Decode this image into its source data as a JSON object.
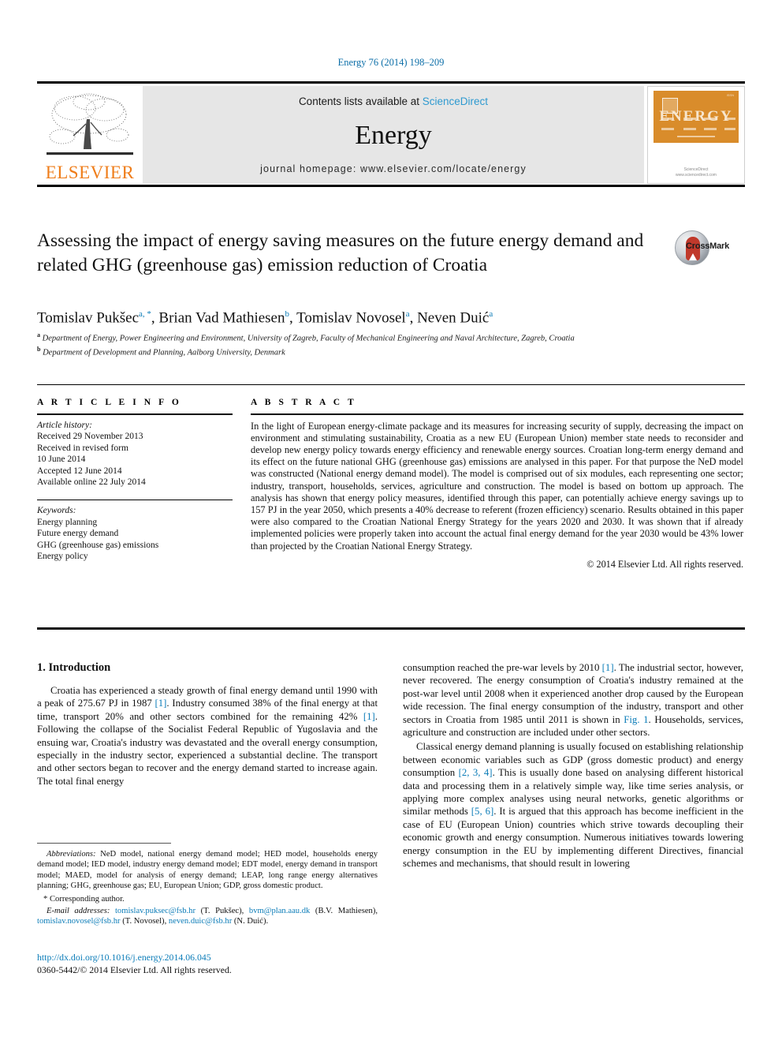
{
  "journal_ref": "Energy 76 (2014) 198–209",
  "masthead": {
    "contents_prefix": "Contents lists available at ",
    "sciencedirect": "ScienceDirect",
    "journal_name": "Energy",
    "homepage": "journal homepage: www.elsevier.com/locate/energy",
    "publisher_wordmark": "ELSEVIER",
    "cover_title": "ENERGY",
    "cover_footer": "ScienceDirect\nwww.sciencedirect.com",
    "accent_link_color": "#2e9ad0",
    "elsevier_orange": "#ef7d1a",
    "cover_orange": "#d98c2b"
  },
  "article": {
    "title": "Assessing the impact of energy saving measures on the future energy demand and related GHG (greenhouse gas) emission reduction of Croatia",
    "crossmark_label": "CrossMark",
    "authors": [
      {
        "name": "Tomislav Pukšec",
        "marks": "a, *"
      },
      {
        "name": "Brian Vad Mathiesen",
        "marks": "b"
      },
      {
        "name": "Tomislav Novosel",
        "marks": "a"
      },
      {
        "name": "Neven Duić",
        "marks": "a"
      }
    ],
    "affiliations": [
      {
        "mark": "a",
        "text": "Department of Energy, Power Engineering and Environment, University of Zagreb, Faculty of Mechanical Engineering and Naval Architecture, Zagreb, Croatia"
      },
      {
        "mark": "b",
        "text": "Department of Development and Planning, Aalborg University, Denmark"
      }
    ]
  },
  "article_info": {
    "heading": "A R T I C L E    I N F O",
    "history_label": "Article history:",
    "history": [
      "Received 29 November 2013",
      "Received in revised form",
      "10 June 2014",
      "Accepted 12 June 2014",
      "Available online 22 July 2014"
    ],
    "keywords_label": "Keywords:",
    "keywords": [
      "Energy planning",
      "Future energy demand",
      "GHG (greenhouse gas) emissions",
      "Energy policy"
    ]
  },
  "abstract": {
    "heading": "A B S T R A C T",
    "text": "In the light of European energy-climate package and its measures for increasing security of supply, decreasing the impact on environment and stimulating sustainability, Croatia as a new EU (European Union) member state needs to reconsider and develop new energy policy towards energy efficiency and renewable energy sources. Croatian long-term energy demand and its effect on the future national GHG (greenhouse gas) emissions are analysed in this paper. For that purpose the NeD model was constructed (National energy demand model). The model is comprised out of six modules, each representing one sector; industry, transport, households, services, agriculture and construction. The model is based on bottom up approach. The analysis has shown that energy policy measures, identified through this paper, can potentially achieve energy savings up to 157 PJ in the year 2050, which presents a 40% decrease to referent (frozen efficiency) scenario. Results obtained in this paper were also compared to the Croatian National Energy Strategy for the years 2020 and 2030. It was shown that if already implemented policies were properly taken into account the actual final energy demand for the year 2030 would be 43% lower than projected by the Croatian National Energy Strategy.",
    "copyright": "© 2014 Elsevier Ltd. All rights reserved."
  },
  "body": {
    "section_heading": "1. Introduction",
    "left_paragraph_1_a": "Croatia has experienced a steady growth of final energy demand until 1990 with a peak of 275.67 PJ in 1987 ",
    "left_ref_1": "[1]",
    "left_paragraph_1_b": ". Industry consumed 38% of the final energy at that time, transport 20% and other sectors combined for the remaining 42% ",
    "left_ref_2": "[1]",
    "left_paragraph_1_c": ". Following the collapse of the Socialist Federal Republic of Yugoslavia and the ensuing war, Croatia's industry was devastated and the overall energy consumption, especially in the industry sector, experienced a substantial decline. The transport and other sectors began to recover and the energy demand started to increase again. The total final energy",
    "right_paragraph_1_a": "consumption reached the pre-war levels by 2010 ",
    "right_ref_1": "[1]",
    "right_paragraph_1_b": ". The industrial sector, however, never recovered. The energy consumption of Croatia's industry remained at the post-war level until 2008 when it experienced another drop caused by the European wide recession. The final energy consumption of the industry, transport and other sectors in Croatia from 1985 until 2011 is shown in ",
    "right_figref": "Fig. 1",
    "right_paragraph_1_c": ". Households, services, agriculture and construction are included under other sectors.",
    "right_paragraph_2_a": "Classical energy demand planning is usually focused on establishing relationship between economic variables such as GDP (gross domestic product) and energy consumption ",
    "right_ref_2": "[2, 3, 4]",
    "right_paragraph_2_b": ". This is usually done based on analysing different historical data and processing them in a relatively simple way, like time series analysis, or applying more complex analyses using neural networks, genetic algorithms or similar methods ",
    "right_ref_3": "[5, 6]",
    "right_paragraph_2_c": ". It is argued that this approach has become inefficient in the case of EU (European Union) countries which strive towards decoupling their economic growth and energy consumption. Numerous initiatives towards lowering energy consumption in the EU by implementing different Directives, financial schemes and mechanisms, that should result in lowering"
  },
  "footnotes": {
    "abbreviations_label": "Abbreviations:",
    "abbreviations_text": " NeD model, national energy demand model; HED model, households energy demand model; IED model, industry energy demand model; EDT model, energy demand in transport model; MAED, model for analysis of energy demand; LEAP, long range energy alternatives planning; GHG, greenhouse gas; EU, European Union; GDP, gross domestic product.",
    "corresponding_author": "Corresponding author.",
    "email_label": "E-mail addresses:",
    "emails": [
      {
        "address": "tomislav.puksec@fsb.hr",
        "owner": " (T. Pukšec), "
      },
      {
        "address": "bvm@plan.aau.dk",
        "owner": " (B.V. Mathiesen), "
      },
      {
        "address": "tomislav.novosel@fsb.hr",
        "owner": " (T. Novosel), "
      },
      {
        "address": "neven.duic@fsb.hr",
        "owner": " (N. Duić)."
      }
    ]
  },
  "footer": {
    "doi": "http://dx.doi.org/10.1016/j.energy.2014.06.045",
    "issn_copyright": "0360-5442/© 2014 Elsevier Ltd. All rights reserved."
  }
}
